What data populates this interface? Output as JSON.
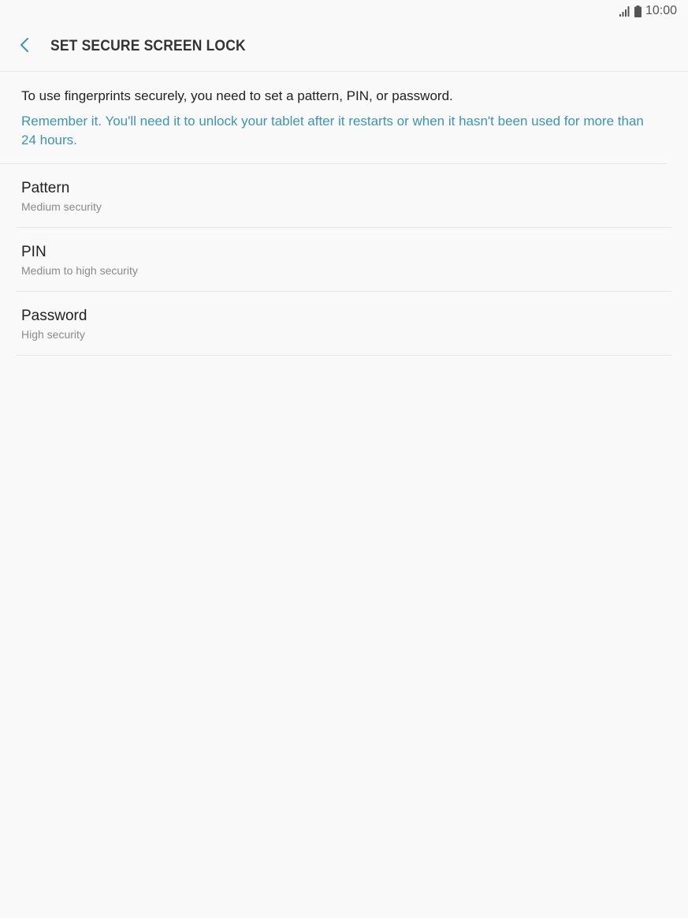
{
  "status_bar": {
    "time": "10:00",
    "signal_icon": "signal-icon",
    "battery_icon": "battery-icon"
  },
  "header": {
    "back_icon": "chevron-left-icon",
    "title": "SET SECURE SCREEN LOCK"
  },
  "intro": {
    "text": "To use fingerprints securely, you need to set a pattern, PIN, or password.",
    "note": "Remember it. You'll need it to unlock your tablet after it restarts or when it hasn't been used for more than 24 hours."
  },
  "options": [
    {
      "title": "Pattern",
      "subtitle": "Medium security"
    },
    {
      "title": "PIN",
      "subtitle": "Medium to high security"
    },
    {
      "title": "Password",
      "subtitle": "High security"
    }
  ],
  "colors": {
    "accent": "#3a95b8",
    "background": "#f9f9f9",
    "divider": "#e6e6e6"
  }
}
